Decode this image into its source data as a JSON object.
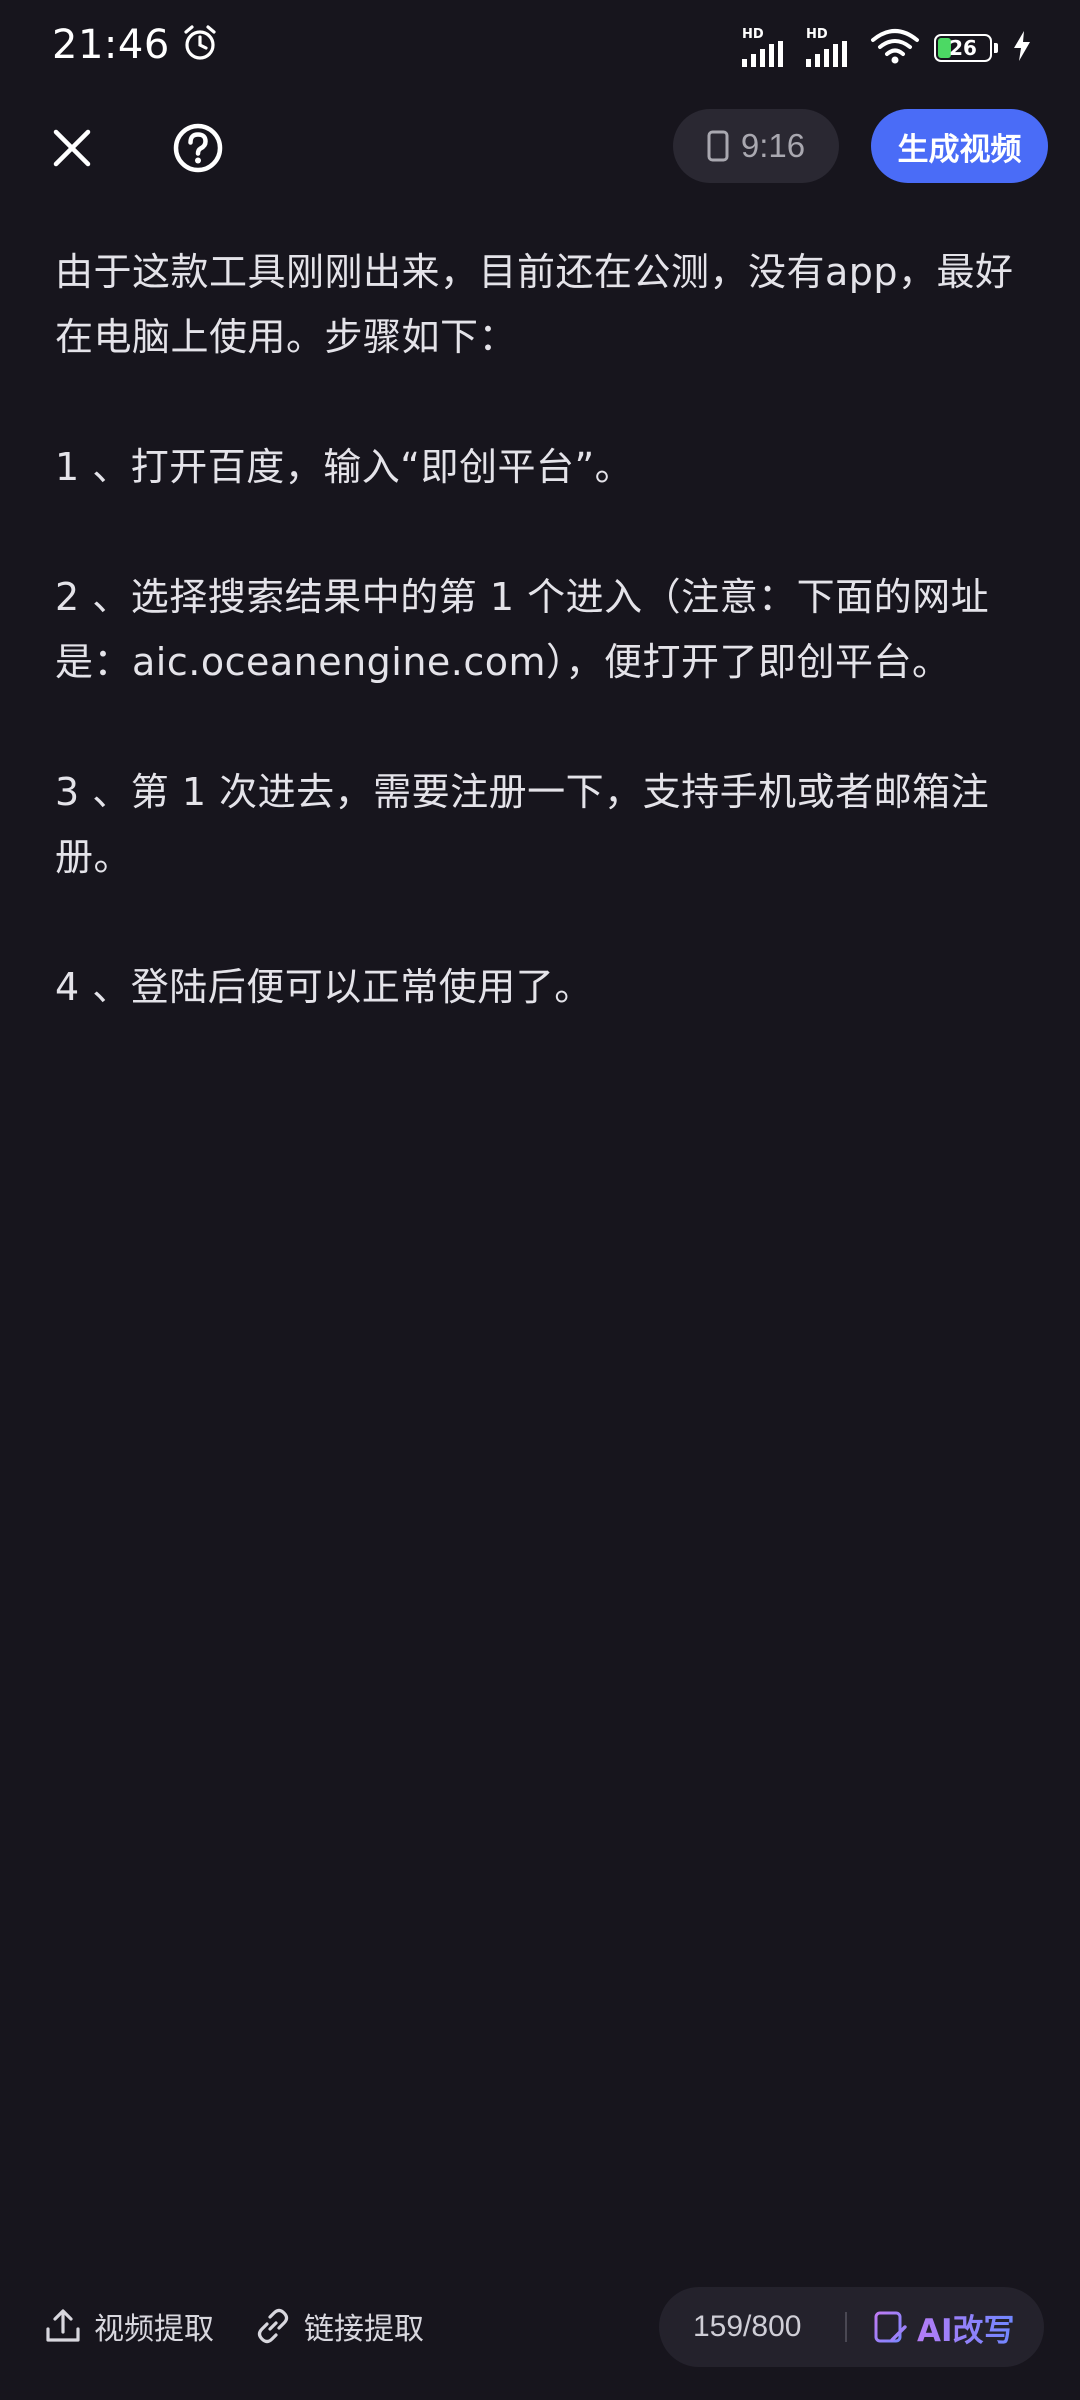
{
  "status_bar": {
    "time": "21:46",
    "hd1": "HD",
    "hd2": "HD",
    "battery": "26"
  },
  "top_bar": {
    "ratio_label": "9:16",
    "generate_label": "生成视频"
  },
  "content": {
    "paragraphs": [
      "由于这款工具刚刚出来，目前还在公测，没有app，最好在电脑上使用。步骤如下：",
      " 1 、打开百度，输入“即创平台”。",
      " 2 、选择搜索结果中的第 1 个进入（注意：下面的网址是：aic.oceanengine.com），便打开了即创平台。",
      " 3 、第 1 次进去，需要注册一下，支持手机或者邮箱注册。",
      " 4 、登陆后便可以正常使用了。"
    ]
  },
  "bottom_bar": {
    "video_extract_label": "视频提取",
    "link_extract_label": "链接提取",
    "char_count": "159/800",
    "ai_rewrite_label": "AI改写"
  },
  "colors": {
    "background": "#17151d",
    "accent": "#4a6cf7",
    "battery_green": "#4cd964"
  },
  "icons": [
    "alarm-icon",
    "signal-icon",
    "wifi-icon",
    "battery-icon",
    "charging-icon",
    "close-icon",
    "help-icon",
    "phone-icon",
    "upload-icon",
    "link-icon",
    "ai-rewrite-icon"
  ]
}
